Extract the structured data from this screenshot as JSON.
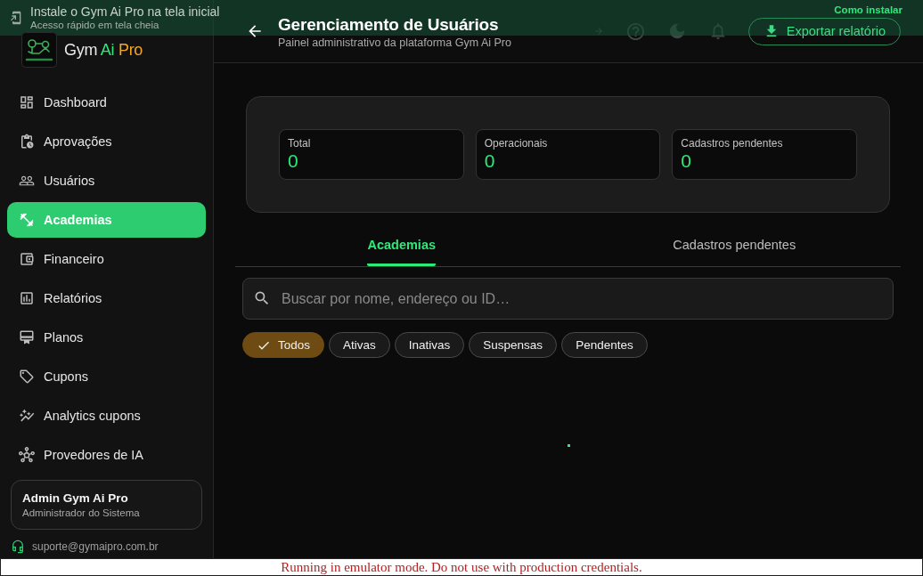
{
  "install_banner": {
    "title": "Instale o Gym Ai Pro na tela inicial",
    "subtitle": "Acesso rápido em tela cheia",
    "action": "Como instalar"
  },
  "sidebar": {
    "brand_parts": [
      {
        "text": "Gym",
        "color": "#e8e8e8"
      },
      {
        "text": "Ai",
        "color": "#2ee87a"
      },
      {
        "text": "Pro",
        "color": "#f5a623"
      }
    ],
    "items": [
      {
        "label": "Dashboard",
        "selected": false
      },
      {
        "label": "Aprovações",
        "selected": false
      },
      {
        "label": "Usuários",
        "selected": false
      },
      {
        "label": "Academias",
        "selected": true
      },
      {
        "label": "Financeiro",
        "selected": false
      },
      {
        "label": "Relatórios",
        "selected": false
      },
      {
        "label": "Planos",
        "selected": false
      },
      {
        "label": "Cupons",
        "selected": false
      },
      {
        "label": "Analytics cupons",
        "selected": false
      },
      {
        "label": "Provedores de IA",
        "selected": false
      }
    ],
    "user": {
      "name": "Admin Gym Ai Pro",
      "role": "Administrador do Sistema"
    },
    "support_email": "suporte@gymaipro.com.br"
  },
  "header": {
    "title": "Gerenciamento de Usuários",
    "subtitle": "Painel administrativo da plataforma Gym Ai Pro",
    "export_button": "Exportar relatório"
  },
  "stats": [
    {
      "label": "Total",
      "value": "0"
    },
    {
      "label": "Operacionais",
      "value": "0"
    },
    {
      "label": "Cadastros pendentes",
      "value": "0"
    }
  ],
  "tabs": [
    {
      "label": "Academias",
      "selected": true
    },
    {
      "label": "Cadastros pendentes",
      "selected": false
    }
  ],
  "search": {
    "placeholder": "Buscar por nome, endereço ou ID…"
  },
  "filters": [
    {
      "label": "Todos",
      "selected": true
    },
    {
      "label": "Ativas",
      "selected": false
    },
    {
      "label": "Inativas",
      "selected": false
    },
    {
      "label": "Suspensas",
      "selected": false
    },
    {
      "label": "Pendentes",
      "selected": false
    }
  ],
  "emulator_notice": "Running in emulator mode. Do not use with production credentials."
}
